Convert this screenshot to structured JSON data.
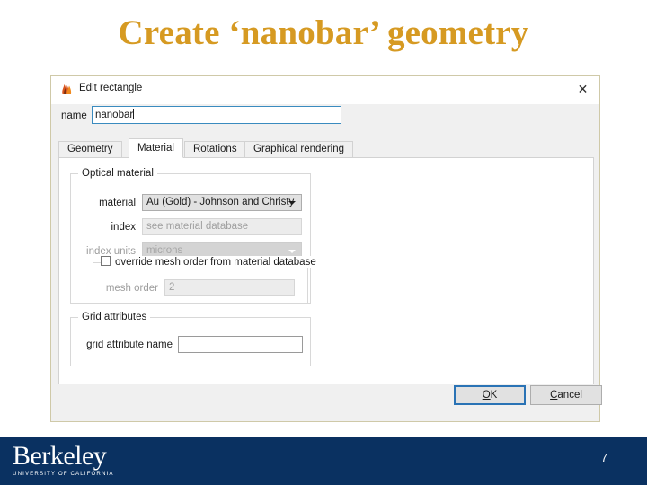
{
  "slide": {
    "title": "Create ‘nanobar’ geometry",
    "title_color": "#d69a22",
    "number": "7"
  },
  "dialog": {
    "titlebar": {
      "app_icon": "meep-flame-icon",
      "title": "Edit rectangle",
      "close_label": "✕"
    },
    "name_field": {
      "label": "name",
      "value": "nanobar",
      "placeholder": ""
    },
    "tabs": [
      {
        "label": "Geometry",
        "active": false
      },
      {
        "label": "Material",
        "active": true
      },
      {
        "label": "Rotations",
        "active": false
      },
      {
        "label": "Graphical rendering",
        "active": false
      }
    ],
    "optical_material": {
      "group_title": "Optical material",
      "material": {
        "label": "material",
        "value": "Au (Gold) - Johnson and Christy",
        "enabled": true
      },
      "index": {
        "label": "index",
        "value": "",
        "placeholder": "see material database",
        "enabled": false
      },
      "index_units": {
        "label": "index units",
        "value": "microns",
        "enabled": false
      },
      "override": {
        "checkbox_label": "override mesh order from material database",
        "checked": false,
        "mesh_order": {
          "label": "mesh order",
          "value": "2",
          "enabled": false
        }
      }
    },
    "grid_attributes": {
      "group_title": "Grid attributes",
      "grid_attribute_name": {
        "label": "grid attribute name",
        "value": "",
        "placeholder": ""
      }
    },
    "buttons": {
      "ok": "OK",
      "ok_mnemonic": "O",
      "cancel": "Cancel",
      "cancel_mnemonic": "C"
    }
  },
  "footer": {
    "logo_word": "Berkeley",
    "logo_subtitle": "UNIVERSITY OF CALIFORNIA",
    "bar_color": "#0a3161"
  }
}
